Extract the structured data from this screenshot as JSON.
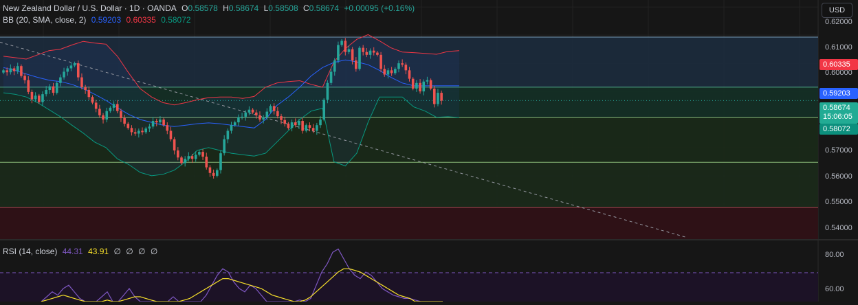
{
  "legend": {
    "symbol": "New Zealand Dollar / U.S. Dollar · 1D · OANDA",
    "open_label": "O",
    "open": "0.58578",
    "high_label": "H",
    "high": "0.58674",
    "low_label": "L",
    "low": "0.58508",
    "close_label": "C",
    "close": "0.58674",
    "change": "+0.00095 (+0.16%)"
  },
  "bb": {
    "label": "BB (20, SMA, close, 2)",
    "basis": "0.59203",
    "upper": "0.60335",
    "lower": "0.58072",
    "colors": {
      "basis": "#2962ff",
      "upper": "#f23645",
      "lower": "#089981"
    }
  },
  "rsi": {
    "label": "RSI (14, close)",
    "rsi_value": "44.31",
    "ma_value": "43.91",
    "empty_values": [
      "∅",
      "∅",
      "∅",
      "∅"
    ],
    "colors": {
      "rsi": "#7e57c2",
      "ma": "#f7e02a"
    }
  },
  "currency_button": "USD",
  "price_axis": {
    "ticks": [
      "0.62000",
      "0.61000",
      "0.60000",
      "0.57000",
      "0.56000",
      "0.55000",
      "0.54000"
    ],
    "rsi_ticks": [
      "80.00",
      "60.00"
    ]
  },
  "price_tags": {
    "upper": "0.60335",
    "basis": "0.59203",
    "last": "0.58674",
    "countdown": "15:06:05",
    "lower": "0.58072"
  },
  "chart_data": {
    "type": "candlestick",
    "y_range": [
      0.5375,
      0.6225
    ],
    "horizontal_levels": [
      0.6093,
      0.5915,
      0.5807,
      0.5648,
      0.5487
    ],
    "candles": {
      "note_units": "price",
      "closes": [
        0.5975,
        0.5968,
        0.5982,
        0.5972,
        0.599,
        0.5955,
        0.594,
        0.5898,
        0.5872,
        0.5885,
        0.5862,
        0.589,
        0.5905,
        0.5918,
        0.5895,
        0.593,
        0.595,
        0.597,
        0.5982,
        0.5992,
        0.6,
        0.595,
        0.5915,
        0.5905,
        0.588,
        0.586,
        0.5838,
        0.5815,
        0.58,
        0.583,
        0.5842,
        0.5855,
        0.583,
        0.5805,
        0.5785,
        0.577,
        0.5755,
        0.575,
        0.576,
        0.5755,
        0.5768,
        0.5775,
        0.5795,
        0.579,
        0.58,
        0.578,
        0.576,
        0.573,
        0.569,
        0.5665,
        0.5645,
        0.566,
        0.567,
        0.566,
        0.5675,
        0.5685,
        0.5668,
        0.563,
        0.561,
        0.56,
        0.562,
        0.568,
        0.573,
        0.576,
        0.578,
        0.579,
        0.5808,
        0.581,
        0.5825,
        0.5835,
        0.5825,
        0.5815,
        0.58,
        0.5808,
        0.5828,
        0.5848,
        0.583,
        0.5812,
        0.5798,
        0.5785,
        0.577,
        0.579,
        0.578,
        0.5795,
        0.576,
        0.578,
        0.577,
        0.576,
        0.578,
        0.58,
        0.587,
        0.593,
        0.597,
        0.601,
        0.6065,
        0.608,
        0.604,
        0.605,
        0.601,
        0.598,
        0.6055,
        0.604,
        0.603,
        0.6045,
        0.6038,
        0.603,
        0.598,
        0.596,
        0.5975,
        0.5965,
        0.598,
        0.6,
        0.5995,
        0.5975,
        0.5945,
        0.591,
        0.593,
        0.59,
        0.5935,
        0.594,
        0.591,
        0.5855,
        0.5895,
        0.5867
      ],
      "bb_upper": [
        0.6025,
        0.602,
        0.6015,
        0.603,
        0.6045,
        0.605,
        0.6065,
        0.6078,
        0.6072,
        0.6068,
        0.6025,
        0.5965,
        0.591,
        0.588,
        0.586,
        0.5852,
        0.586,
        0.587,
        0.5878,
        0.588,
        0.588,
        0.5875,
        0.5882,
        0.5915,
        0.593,
        0.5935,
        0.5938,
        0.5925,
        0.5915,
        0.6005,
        0.6052,
        0.6085,
        0.6102,
        0.608,
        0.6055,
        0.604,
        0.6038,
        0.6035,
        0.6032,
        0.6042,
        0.6045
      ],
      "bb_basis": [
        0.5985,
        0.5975,
        0.5962,
        0.595,
        0.594,
        0.5935,
        0.5925,
        0.591,
        0.589,
        0.5868,
        0.5842,
        0.5818,
        0.58,
        0.579,
        0.578,
        0.5775,
        0.578,
        0.5785,
        0.5788,
        0.5785,
        0.578,
        0.5775,
        0.577,
        0.58,
        0.585,
        0.588,
        0.5915,
        0.5955,
        0.5985,
        0.6003,
        0.6012,
        0.6005,
        0.5995,
        0.5975,
        0.595,
        0.593,
        0.592,
        0.592,
        0.592,
        0.592,
        0.592
      ],
      "bb_lower": [
        0.5895,
        0.589,
        0.588,
        0.586,
        0.5835,
        0.581,
        0.578,
        0.5752,
        0.572,
        0.57,
        0.566,
        0.564,
        0.5612,
        0.56,
        0.5605,
        0.562,
        0.565,
        0.569,
        0.57,
        0.569,
        0.568,
        0.5675,
        0.567,
        0.568,
        0.572,
        0.576,
        0.58,
        0.583,
        0.584,
        0.565,
        0.5635,
        0.568,
        0.579,
        0.588,
        0.588,
        0.588,
        0.5845,
        0.583,
        0.5808,
        0.581,
        0.5807
      ]
    },
    "rsi_series": {
      "rsi": [
        50,
        55,
        58,
        56,
        60,
        62,
        58,
        54,
        50,
        48,
        52,
        55,
        58,
        52,
        50,
        56,
        60,
        55,
        52,
        48,
        45,
        42,
        46,
        50,
        55,
        52,
        48,
        46,
        44,
        50,
        56,
        62,
        68,
        72,
        70,
        64,
        60,
        58,
        62,
        60,
        56,
        52,
        50,
        48,
        47,
        49,
        51,
        53,
        52,
        54,
        62,
        70,
        75,
        82,
        84,
        78,
        72,
        68,
        66,
        70,
        68,
        64,
        60,
        58,
        56,
        55,
        54,
        54,
        53,
        52,
        48,
        45,
        44,
        44
      ],
      "ma": [
        52,
        53,
        54,
        55,
        56,
        55,
        54,
        53,
        52,
        52,
        51,
        52,
        53,
        52,
        52,
        53,
        54,
        55,
        55,
        54,
        53,
        52,
        51,
        51,
        51,
        52,
        53,
        54,
        56,
        58,
        60,
        62,
        64,
        66,
        66,
        65,
        64,
        63,
        62,
        61,
        60,
        58,
        56,
        55,
        54,
        53,
        52,
        52,
        53,
        55,
        58,
        61,
        64,
        67,
        70,
        72,
        72,
        71,
        70,
        68,
        66,
        64,
        62,
        60,
        58,
        56,
        55,
        54,
        52,
        50,
        48,
        46,
        44,
        44
      ]
    }
  }
}
